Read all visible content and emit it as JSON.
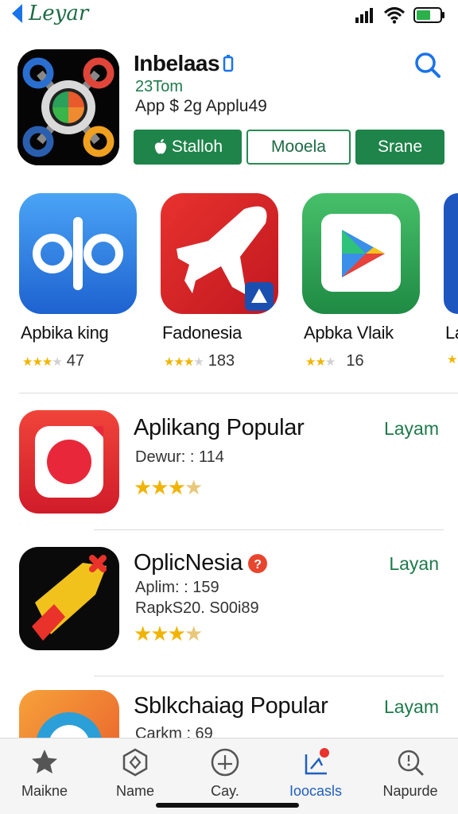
{
  "status": {
    "back_label": "Leyar"
  },
  "hero": {
    "title": "Inbelaas",
    "subtitle": "23Tom",
    "meta": "App $ 2g Applu49",
    "buttons": {
      "install": "Stalloh",
      "middle": "Mooela",
      "share": "Srane"
    }
  },
  "carousel": [
    {
      "name": "Apbika king",
      "count": "47"
    },
    {
      "name": "Fadonesia",
      "count": "183"
    },
    {
      "name": "Apbka Vlaik",
      "count": "16"
    },
    {
      "name": "La",
      "count": ""
    }
  ],
  "list": [
    {
      "title": "Aplikang Popular",
      "meta1": "Dewur: : 114",
      "meta2": "",
      "action": "Layam"
    },
    {
      "title": "OplicNesia",
      "meta1": "Aplim: : 159",
      "meta2": "RapkS20. S00i89",
      "action": "Layan"
    },
    {
      "title": "Sblkchaiag Popular",
      "meta1": "Carkm : 69",
      "meta2": "",
      "action": "Layam"
    }
  ],
  "tabs": [
    {
      "label": "Maikne"
    },
    {
      "label": "Name"
    },
    {
      "label": "Cay."
    },
    {
      "label": "Ioocasls"
    },
    {
      "label": "Napurde"
    }
  ],
  "colors": {
    "accent_green": "#1e8449",
    "link_blue": "#1f5fbf",
    "star": "#f0b400"
  }
}
